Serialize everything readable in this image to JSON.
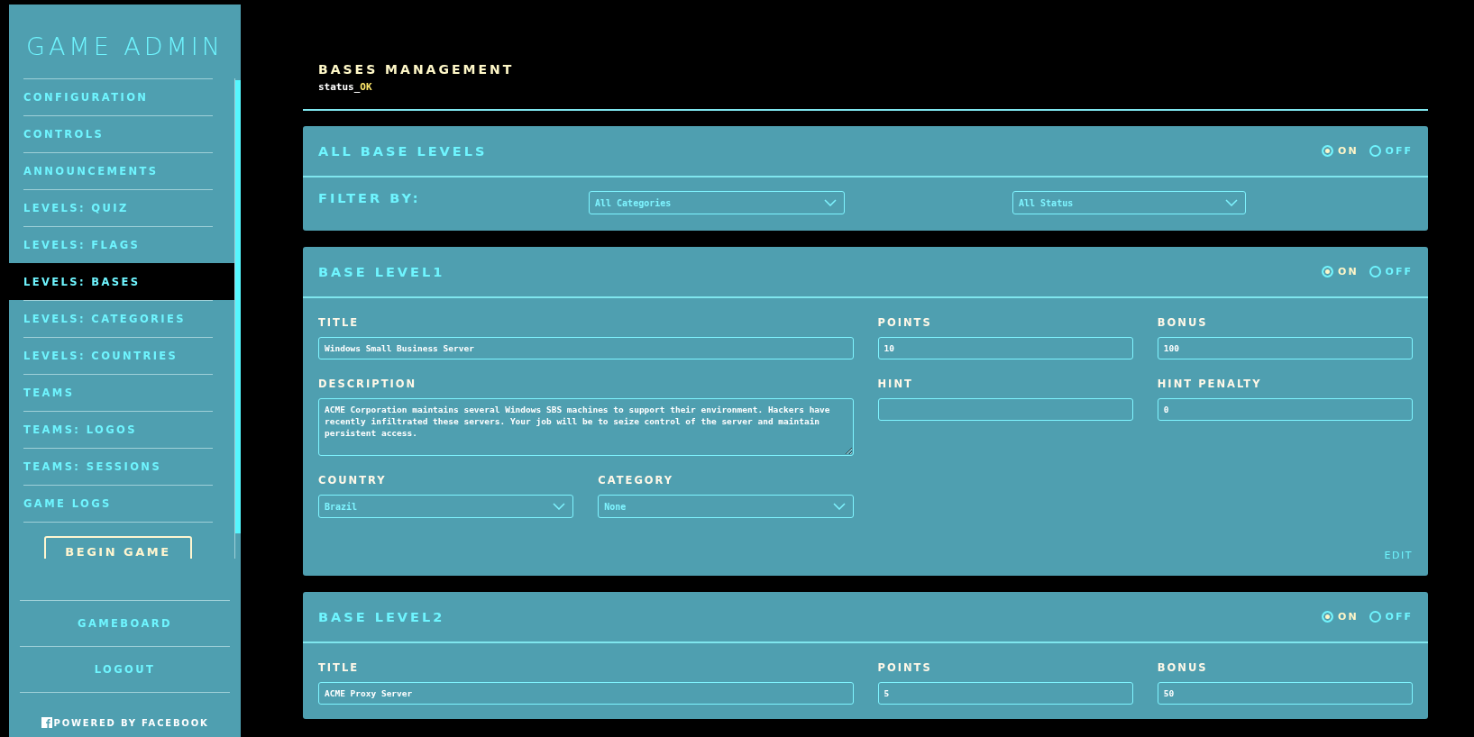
{
  "sidebar": {
    "title": "GAME ADMIN",
    "items": [
      {
        "label": "CONFIGURATION",
        "selected": false
      },
      {
        "label": "CONTROLS",
        "selected": false
      },
      {
        "label": "ANNOUNCEMENTS",
        "selected": false
      },
      {
        "label": "LEVELS: QUIZ",
        "selected": false
      },
      {
        "label": "LEVELS: FLAGS",
        "selected": false
      },
      {
        "label": "LEVELS: BASES",
        "selected": true
      },
      {
        "label": "LEVELS: CATEGORIES",
        "selected": false
      },
      {
        "label": "LEVELS: COUNTRIES",
        "selected": false
      },
      {
        "label": "TEAMS",
        "selected": false
      },
      {
        "label": "TEAMS: LOGOS",
        "selected": false
      },
      {
        "label": "TEAMS: SESSIONS",
        "selected": false
      },
      {
        "label": "GAME LOGS",
        "selected": false
      }
    ],
    "begin_button": "BEGIN GAME",
    "footer_links": [
      "GAMEBOARD",
      "LOGOUT"
    ],
    "powered_by": "POWERED BY FACEBOOK"
  },
  "header": {
    "title": "BASES MANAGEMENT",
    "status_label": "status_",
    "status_value": "OK"
  },
  "filter_panel": {
    "title": "ALL BASE LEVELS",
    "toggle": [
      {
        "label": "ON",
        "selected": true
      },
      {
        "label": "OFF",
        "selected": false
      }
    ],
    "filter_label": "FILTER BY:",
    "filters": [
      {
        "value": "All Categories"
      },
      {
        "value": "All Status"
      }
    ]
  },
  "levels": [
    {
      "title": "BASE LEVEL1",
      "toggle": [
        {
          "label": "ON",
          "selected": true
        },
        {
          "label": "OFF",
          "selected": false
        }
      ],
      "fields": {
        "title": {
          "label": "TITLE",
          "value": "Windows Small Business Server"
        },
        "points": {
          "label": "POINTS",
          "value": "10"
        },
        "bonus": {
          "label": "BONUS",
          "value": "100"
        },
        "description": {
          "label": "DESCRIPTION",
          "value": "ACME Corporation maintains several Windows SBS machines to support their environment. Hackers have recently infiltrated these servers. Your job will be to seize control of the server and maintain persistent access."
        },
        "hint": {
          "label": "HINT"
        },
        "hint_penalty": {
          "label": "HINT PENALTY",
          "value": "0"
        },
        "country": {
          "label": "COUNTRY",
          "value": "Brazil"
        },
        "category": {
          "label": "CATEGORY",
          "value": "None"
        }
      },
      "edit": "EDIT"
    },
    {
      "title": "BASE LEVEL2",
      "toggle": [
        {
          "label": "ON",
          "selected": true
        },
        {
          "label": "OFF",
          "selected": false
        }
      ],
      "fields": {
        "title": {
          "label": "TITLE",
          "value": "ACME Proxy Server"
        },
        "points": {
          "label": "POINTS",
          "value": "5"
        },
        "bonus": {
          "label": "BONUS",
          "value": "50"
        }
      }
    }
  ]
}
